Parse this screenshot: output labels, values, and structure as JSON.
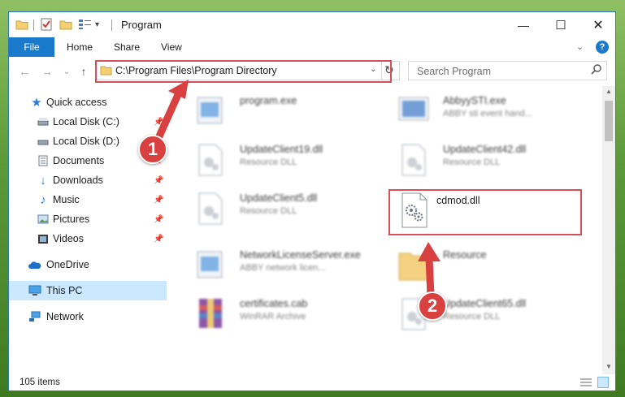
{
  "window": {
    "title": "Program",
    "minimize": "—",
    "maximize": "☐",
    "close": "✕"
  },
  "ribbon": {
    "tabs": [
      "File",
      "Home",
      "Share",
      "View"
    ],
    "help": "?"
  },
  "address": {
    "path": "C:\\Program Files\\Program Directory"
  },
  "search": {
    "placeholder": "Search Program"
  },
  "sidebar": {
    "items": [
      {
        "label": "Quick access",
        "icon": "star-icon"
      },
      {
        "label": "Local Disk (C:)",
        "icon": "drive-icon",
        "pinned": true
      },
      {
        "label": "Local Disk (D:)",
        "icon": "drive-icon"
      },
      {
        "label": "Documents",
        "icon": "documents-icon",
        "pinned": true
      },
      {
        "label": "Downloads",
        "icon": "download-icon",
        "pinned": true
      },
      {
        "label": "Music",
        "icon": "music-icon",
        "pinned": true
      },
      {
        "label": "Pictures",
        "icon": "pictures-icon",
        "pinned": true
      },
      {
        "label": "Videos",
        "icon": "videos-icon",
        "pinned": true
      },
      {
        "label": "OneDrive",
        "icon": "cloud-icon"
      },
      {
        "label": "This PC",
        "icon": "monitor-icon",
        "selected": true
      },
      {
        "label": "Network",
        "icon": "network-icon"
      }
    ]
  },
  "files": [
    {
      "name": "program.exe",
      "desc": "",
      "icon": "exe-icon"
    },
    {
      "name": "AbbyySTI.exe",
      "desc": "ABBY sti event hand...",
      "icon": "exe-icon"
    },
    {
      "name": "UpdateClient19.dll",
      "desc": "Resource DLL",
      "icon": "dll-icon"
    },
    {
      "name": "UpdateClient42.dll",
      "desc": "Resource DLL",
      "icon": "dll-icon"
    },
    {
      "name": "UpdateClient5.dll",
      "desc": "Resource DLL",
      "icon": "dll-icon"
    },
    {
      "name": "cdmod.dll",
      "desc": "",
      "icon": "dll-icon"
    },
    {
      "name": "NetworkLicenseServer.exe",
      "desc": "ABBY network licen...",
      "icon": "exe-icon"
    },
    {
      "name": "Resource",
      "desc": "",
      "icon": "folder-icon"
    },
    {
      "name": "certificates.cab",
      "desc": "WinRAR Archive",
      "icon": "archive-icon"
    },
    {
      "name": "UpdateClient65.dll",
      "desc": "Resource DLL",
      "icon": "dll-icon"
    }
  ],
  "status": {
    "count": "105 items"
  },
  "annotations": {
    "step1": "1",
    "step2": "2",
    "highlight_color": "#d6505c"
  }
}
